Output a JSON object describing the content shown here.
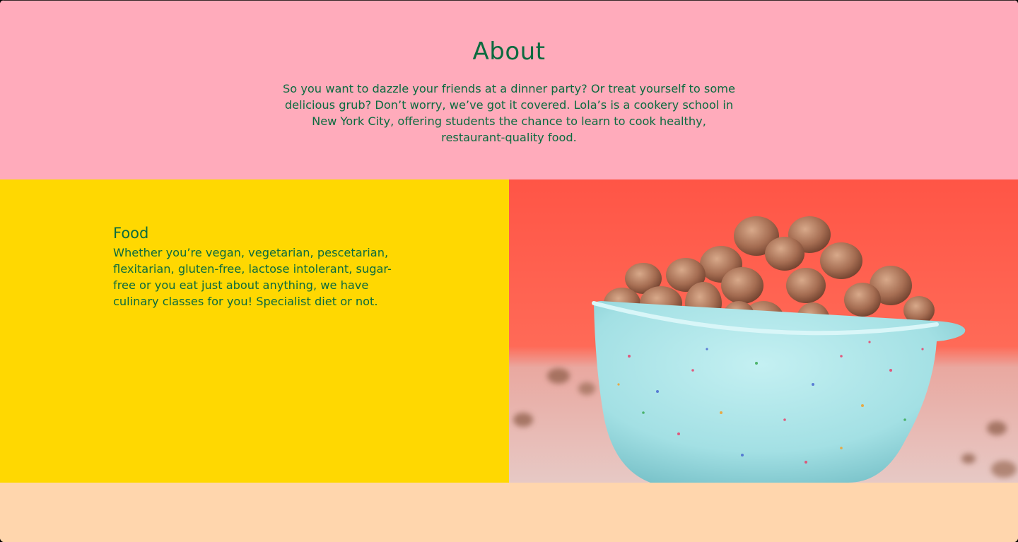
{
  "about": {
    "title": "About",
    "text": "So you want to dazzle your friends at a dinner party? Or treat yourself to some delicious grub? Don’t worry, we’ve got it covered. Lola’s is a cookery school in New York City, offering students the chance to learn to cook healthy, restaurant-quality food."
  },
  "food": {
    "title": "Food",
    "text": "Whether you’re vegan, vegetarian, pescetarian, flexitarian, gluten-free, lactose intolerant, sugar-free or you eat just about anything, we have culinary classes for you! Specialist diet or not."
  },
  "photo": {
    "icon": "bowl-of-candied-nuts-photo"
  },
  "colors": {
    "about_bg": "#ffabbb",
    "food_bg": "#ffd801",
    "footer_bg": "#ffd6ad",
    "text": "#0b6b3f",
    "photo_bg": "#ff5a4a",
    "bowl": "#a8e3e6"
  }
}
